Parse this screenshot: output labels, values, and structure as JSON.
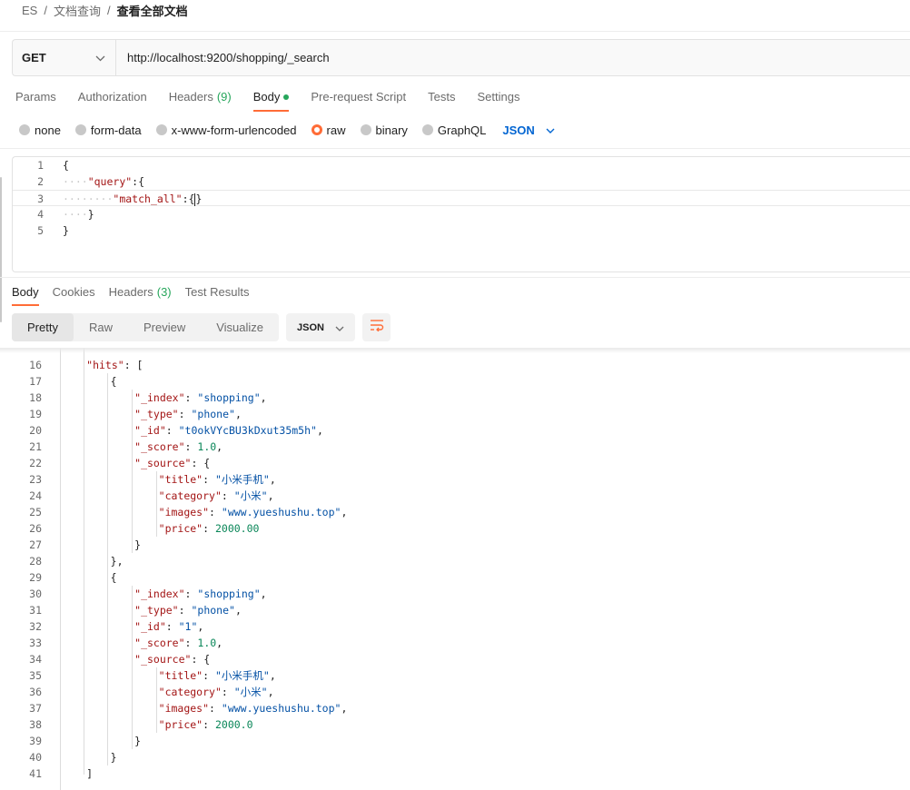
{
  "breadcrumb": {
    "items": [
      "ES",
      "文档查询"
    ],
    "current": "查看全部文档"
  },
  "request": {
    "method": "GET",
    "url": "http://localhost:9200/shopping/_search"
  },
  "request_tabs": [
    {
      "label": "Params"
    },
    {
      "label": "Authorization"
    },
    {
      "label": "Headers",
      "count": "(9)"
    },
    {
      "label": "Body",
      "active": true,
      "dot": true
    },
    {
      "label": "Pre-request Script"
    },
    {
      "label": "Tests"
    },
    {
      "label": "Settings"
    }
  ],
  "body_types": [
    {
      "label": "none"
    },
    {
      "label": "form-data"
    },
    {
      "label": "x-www-form-urlencoded"
    },
    {
      "label": "raw",
      "checked": true
    },
    {
      "label": "binary"
    },
    {
      "label": "GraphQL"
    }
  ],
  "body_format": "JSON",
  "editor_lines": [
    {
      "n": "1",
      "tokens": [
        [
          "br",
          "{"
        ]
      ]
    },
    {
      "n": "2",
      "tokens": [
        [
          "ws",
          "····"
        ],
        [
          "key",
          "\"query\""
        ],
        [
          "br",
          ":{"
        ]
      ]
    },
    {
      "n": "3",
      "highlight": true,
      "tokens": [
        [
          "ws",
          "····"
        ],
        [
          "ws",
          "····"
        ],
        [
          "key",
          "\"match_all\""
        ],
        [
          "br",
          ":{"
        ],
        [
          "cursor",
          ""
        ],
        [
          "br",
          "}"
        ]
      ]
    },
    {
      "n": "4",
      "tokens": [
        [
          "ws",
          "····"
        ],
        [
          "br",
          "}"
        ]
      ]
    },
    {
      "n": "5",
      "tokens": [
        [
          "br",
          "}"
        ]
      ]
    }
  ],
  "response_tabs": [
    {
      "label": "Body",
      "active": true
    },
    {
      "label": "Cookies"
    },
    {
      "label": "Headers",
      "count": "(3)"
    },
    {
      "label": "Test Results"
    }
  ],
  "view_modes": [
    {
      "label": "Pretty",
      "active": true
    },
    {
      "label": "Raw"
    },
    {
      "label": "Preview"
    },
    {
      "label": "Visualize"
    }
  ],
  "response_format": "JSON",
  "response_lines": [
    {
      "n": "16",
      "indent": 2,
      "tokens": [
        [
          "key",
          "\"hits\""
        ],
        [
          "br",
          ": ["
        ]
      ]
    },
    {
      "n": "17",
      "indent": 3,
      "tokens": [
        [
          "br",
          "{"
        ]
      ]
    },
    {
      "n": "18",
      "indent": 4,
      "tokens": [
        [
          "key",
          "\"_index\""
        ],
        [
          "br",
          ": "
        ],
        [
          "str",
          "\"shopping\""
        ],
        [
          "br",
          ","
        ]
      ]
    },
    {
      "n": "19",
      "indent": 4,
      "tokens": [
        [
          "key",
          "\"_type\""
        ],
        [
          "br",
          ": "
        ],
        [
          "str",
          "\"phone\""
        ],
        [
          "br",
          ","
        ]
      ]
    },
    {
      "n": "20",
      "indent": 4,
      "tokens": [
        [
          "key",
          "\"_id\""
        ],
        [
          "br",
          ": "
        ],
        [
          "str",
          "\"t0okVYcBU3kDxut35m5h\""
        ],
        [
          "br",
          ","
        ]
      ]
    },
    {
      "n": "21",
      "indent": 4,
      "tokens": [
        [
          "key",
          "\"_score\""
        ],
        [
          "br",
          ": "
        ],
        [
          "num",
          "1.0"
        ],
        [
          "br",
          ","
        ]
      ]
    },
    {
      "n": "22",
      "indent": 4,
      "tokens": [
        [
          "key",
          "\"_source\""
        ],
        [
          "br",
          ": {"
        ]
      ]
    },
    {
      "n": "23",
      "indent": 5,
      "tokens": [
        [
          "key",
          "\"title\""
        ],
        [
          "br",
          ": "
        ],
        [
          "str",
          "\"小米手机\""
        ],
        [
          "br",
          ","
        ]
      ]
    },
    {
      "n": "24",
      "indent": 5,
      "tokens": [
        [
          "key",
          "\"category\""
        ],
        [
          "br",
          ": "
        ],
        [
          "str",
          "\"小米\""
        ],
        [
          "br",
          ","
        ]
      ]
    },
    {
      "n": "25",
      "indent": 5,
      "tokens": [
        [
          "key",
          "\"images\""
        ],
        [
          "br",
          ": "
        ],
        [
          "str",
          "\"www.yueshushu.top\""
        ],
        [
          "br",
          ","
        ]
      ]
    },
    {
      "n": "26",
      "indent": 5,
      "tokens": [
        [
          "key",
          "\"price\""
        ],
        [
          "br",
          ": "
        ],
        [
          "num",
          "2000.00"
        ]
      ]
    },
    {
      "n": "27",
      "indent": 4,
      "tokens": [
        [
          "br",
          "}"
        ]
      ]
    },
    {
      "n": "28",
      "indent": 3,
      "tokens": [
        [
          "br",
          "},"
        ]
      ]
    },
    {
      "n": "29",
      "indent": 3,
      "tokens": [
        [
          "br",
          "{"
        ]
      ]
    },
    {
      "n": "30",
      "indent": 4,
      "tokens": [
        [
          "key",
          "\"_index\""
        ],
        [
          "br",
          ": "
        ],
        [
          "str",
          "\"shopping\""
        ],
        [
          "br",
          ","
        ]
      ]
    },
    {
      "n": "31",
      "indent": 4,
      "tokens": [
        [
          "key",
          "\"_type\""
        ],
        [
          "br",
          ": "
        ],
        [
          "str",
          "\"phone\""
        ],
        [
          "br",
          ","
        ]
      ]
    },
    {
      "n": "32",
      "indent": 4,
      "tokens": [
        [
          "key",
          "\"_id\""
        ],
        [
          "br",
          ": "
        ],
        [
          "str",
          "\"1\""
        ],
        [
          "br",
          ","
        ]
      ]
    },
    {
      "n": "33",
      "indent": 4,
      "tokens": [
        [
          "key",
          "\"_score\""
        ],
        [
          "br",
          ": "
        ],
        [
          "num",
          "1.0"
        ],
        [
          "br",
          ","
        ]
      ]
    },
    {
      "n": "34",
      "indent": 4,
      "tokens": [
        [
          "key",
          "\"_source\""
        ],
        [
          "br",
          ": {"
        ]
      ]
    },
    {
      "n": "35",
      "indent": 5,
      "tokens": [
        [
          "key",
          "\"title\""
        ],
        [
          "br",
          ": "
        ],
        [
          "str",
          "\"小米手机\""
        ],
        [
          "br",
          ","
        ]
      ]
    },
    {
      "n": "36",
      "indent": 5,
      "tokens": [
        [
          "key",
          "\"category\""
        ],
        [
          "br",
          ": "
        ],
        [
          "str",
          "\"小米\""
        ],
        [
          "br",
          ","
        ]
      ]
    },
    {
      "n": "37",
      "indent": 5,
      "tokens": [
        [
          "key",
          "\"images\""
        ],
        [
          "br",
          ": "
        ],
        [
          "str",
          "\"www.yueshushu.top\""
        ],
        [
          "br",
          ","
        ]
      ]
    },
    {
      "n": "38",
      "indent": 5,
      "tokens": [
        [
          "key",
          "\"price\""
        ],
        [
          "br",
          ": "
        ],
        [
          "num",
          "2000.0"
        ]
      ]
    },
    {
      "n": "39",
      "indent": 4,
      "tokens": [
        [
          "br",
          "}"
        ]
      ]
    },
    {
      "n": "40",
      "indent": 3,
      "tokens": [
        [
          "br",
          "}"
        ]
      ]
    },
    {
      "n": "41",
      "indent": 2,
      "tokens": [
        [
          "br",
          "]"
        ]
      ]
    }
  ],
  "colors": {
    "accent": "#ff6c37",
    "link": "#0265d2",
    "json_key": "#a31515",
    "json_string": "#0451a5",
    "json_number": "#098658",
    "count": "#26a65b"
  },
  "icons": {
    "method_dropdown": "chevron-down-icon",
    "wrap_toggle": "wrap-lines-icon"
  }
}
